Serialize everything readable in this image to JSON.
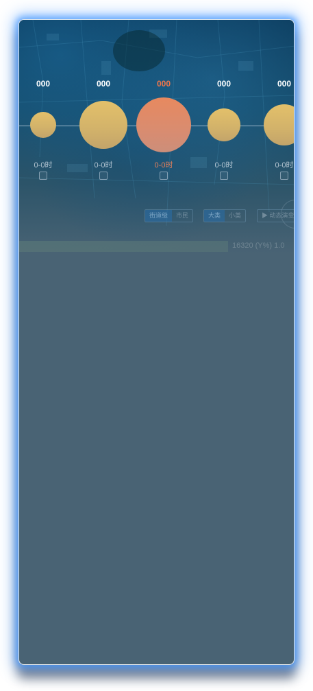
{
  "timeline": {
    "slots": [
      {
        "value": "000",
        "range": "0-0时",
        "active": false,
        "color": "#d9b86a"
      },
      {
        "value": "000",
        "range": "0-0时",
        "active": false,
        "color": "#d9b86a"
      },
      {
        "value": "000",
        "range": "0-0时",
        "active": true,
        "color": "#e08a66"
      },
      {
        "value": "000",
        "range": "0-0时",
        "active": false,
        "color": "#d9b86a"
      },
      {
        "value": "000",
        "range": "0-0时",
        "active": false,
        "color": "#d9b86a"
      }
    ]
  },
  "controls": {
    "group_a": [
      "街道级",
      "市民"
    ],
    "group_b": [
      "大类",
      "小类"
    ],
    "play_label": "▶ 动态演变"
  },
  "map": {
    "coord_readout": "16320 (Y%) 1.0"
  },
  "colors": {
    "accent_glow": "#4296ff",
    "panel_bg": "#496374",
    "active_text": "#f0764a",
    "bubble_yellow": "#d9b86a",
    "bubble_orange": "#e08a66"
  }
}
